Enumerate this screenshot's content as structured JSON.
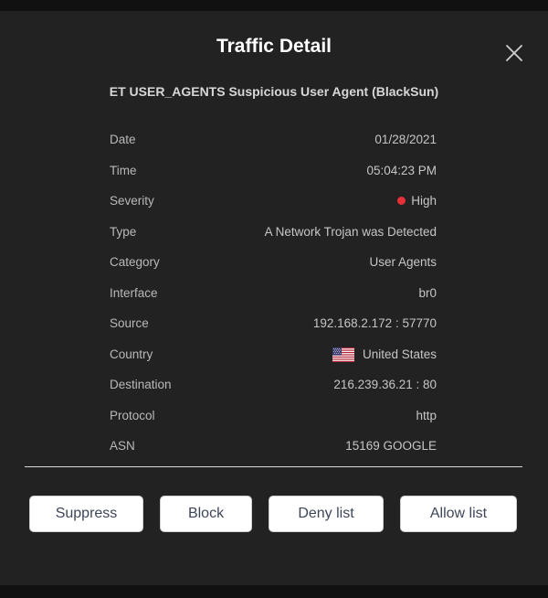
{
  "modal": {
    "title": "Traffic Detail",
    "subtitle": "ET USER_AGENTS Suspicious User Agent (BlackSun)",
    "close_icon": "close-icon"
  },
  "details": {
    "date": {
      "label": "Date",
      "value": "01/28/2021"
    },
    "time": {
      "label": "Time",
      "value": "05:04:23 PM"
    },
    "severity": {
      "label": "Severity",
      "value": "High",
      "indicator_color": "#e8303b"
    },
    "type": {
      "label": "Type",
      "value": "A Network Trojan was Detected"
    },
    "category": {
      "label": "Category",
      "value": "User Agents"
    },
    "interface": {
      "label": "Interface",
      "value": "br0"
    },
    "source": {
      "label": "Source",
      "value": "192.168.2.172 : 57770"
    },
    "country": {
      "label": "Country",
      "value": "United States",
      "flag_icon": "us-flag-icon"
    },
    "destination": {
      "label": "Destination",
      "value": "216.239.36.21 : 80"
    },
    "protocol": {
      "label": "Protocol",
      "value": "http"
    },
    "asn": {
      "label": "ASN",
      "value": "15169 GOOGLE"
    }
  },
  "actions": {
    "suppress": "Suppress",
    "block": "Block",
    "deny_list": "Deny list",
    "allow_list": "Allow list"
  },
  "colors": {
    "modal_background": "#222223",
    "page_background": "#111112",
    "button_text": "#3d4658",
    "severity_high": "#e8303b"
  }
}
